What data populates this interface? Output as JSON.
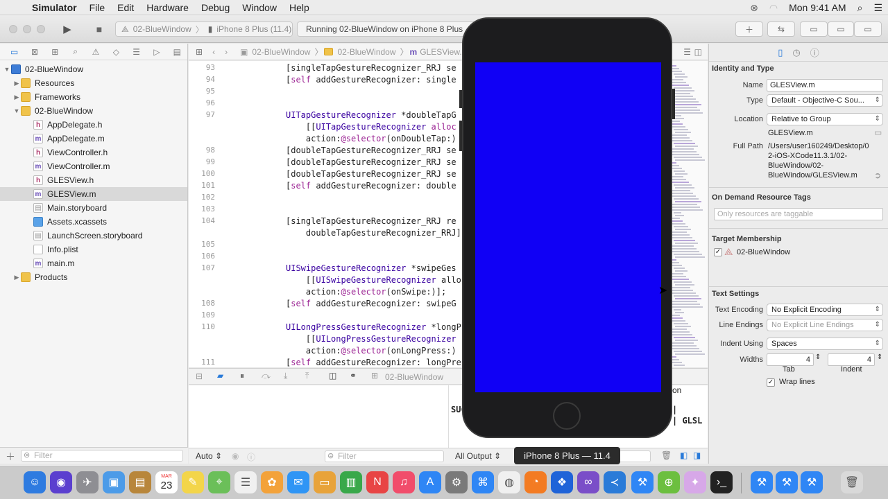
{
  "menubar": {
    "app_name": "Simulator",
    "items": [
      "File",
      "Edit",
      "Hardware",
      "Debug",
      "Window",
      "Help"
    ],
    "clock": "Mon 9:41 AM"
  },
  "toolbar": {
    "scheme": "02-BlueWindow",
    "destination": "iPhone 8 Plus (11.4)",
    "activity": "Running 02-BlueWindow on iPhone 8 Plus"
  },
  "navigator": {
    "items": [
      {
        "label": "02-BlueWindow",
        "kind": "project"
      },
      {
        "label": "Resources",
        "kind": "folder"
      },
      {
        "label": "Frameworks",
        "kind": "folder"
      },
      {
        "label": "02-BlueWindow",
        "kind": "folder"
      },
      {
        "label": "AppDelegate.h",
        "kind": "h"
      },
      {
        "label": "AppDelegate.m",
        "kind": "m"
      },
      {
        "label": "ViewController.h",
        "kind": "h"
      },
      {
        "label": "ViewController.m",
        "kind": "m"
      },
      {
        "label": "GLESView.h",
        "kind": "h"
      },
      {
        "label": "GLESView.m",
        "kind": "m"
      },
      {
        "label": "Main.storyboard",
        "kind": "sb"
      },
      {
        "label": "Assets.xcassets",
        "kind": "xc"
      },
      {
        "label": "LaunchScreen.storyboard",
        "kind": "sb"
      },
      {
        "label": "Info.plist",
        "kind": "pl"
      },
      {
        "label": "main.m",
        "kind": "m"
      },
      {
        "label": "Products",
        "kind": "folder"
      }
    ],
    "filter_placeholder": "Filter"
  },
  "jumpbar": {
    "crumbs": [
      "02-BlueWindow",
      "02-BlueWindow",
      "GLESView.m"
    ]
  },
  "editor": {
    "lines": [
      {
        "n": "93",
        "text": "[singleTapGestureRecognizer_RRJ se"
      },
      {
        "n": "94",
        "text": "[self addGestureRecognizer: single"
      },
      {
        "n": "95",
        "text": ""
      },
      {
        "n": "96",
        "text": ""
      },
      {
        "n": "97",
        "text": "UITapGestureRecognizer *doubleTapG"
      },
      {
        "n": "",
        "text": "    [[UITapGestureRecognizer alloc"
      },
      {
        "n": "",
        "text": "    action:@selector(onDoubleTap:)"
      },
      {
        "n": "98",
        "text": "[doubleTapGestureRecognizer_RRJ se"
      },
      {
        "n": "99",
        "text": "[doubleTapGestureRecognizer_RRJ se"
      },
      {
        "n": "100",
        "text": "[doubleTapGestureRecognizer_RRJ se"
      },
      {
        "n": "101",
        "text": "[self addGestureRecognizer: double"
      },
      {
        "n": "102",
        "text": ""
      },
      {
        "n": "103",
        "text": ""
      },
      {
        "n": "104",
        "text": "[singleTapGestureRecognizer_RRJ re"
      },
      {
        "n": "",
        "text": "    doubleTapGestureRecognizer_RRJ]"
      },
      {
        "n": "105",
        "text": ""
      },
      {
        "n": "106",
        "text": ""
      },
      {
        "n": "107",
        "text": "UISwipeGestureRecognizer *swipeGes"
      },
      {
        "n": "",
        "text": "    [[UISwipeGestureRecognizer allo"
      },
      {
        "n": "",
        "text": "    action:@selector(onSwipe:)];"
      },
      {
        "n": "108",
        "text": "[self addGestureRecognizer: swipeG"
      },
      {
        "n": "109",
        "text": ""
      },
      {
        "n": "110",
        "text": "UILongPressGestureRecognizer *longP"
      },
      {
        "n": "",
        "text": "    [[UILongPressGestureRecognizer"
      },
      {
        "n": "",
        "text": "    action:@selector(onLongPress:)"
      },
      {
        "n": "111",
        "text": "[self addGestureRecognizer: longPre"
      }
    ]
  },
  "debug": {
    "process": "02-BlueWindow",
    "console_partial_1": "SUC",
    "console_partial_2": "| GLSL",
    "console_partial_3": "on",
    "auto_label": "Auto",
    "filter_placeholder": "Filter",
    "output_label": "All Output"
  },
  "inspector": {
    "identity_title": "Identity and Type",
    "name_label": "Name",
    "name_value": "GLESView.m",
    "type_label": "Type",
    "type_value": "Default - Objective-C Sou...",
    "location_label": "Location",
    "location_value": "Relative to Group",
    "location_file": "GLESView.m",
    "full_path_label": "Full Path",
    "full_path_value": "/Users/user160249/Desktop/02-iOS-XCode11.3.1/02-BlueWindow/02-BlueWindow/GLESView.m",
    "on_demand_title": "On Demand Resource Tags",
    "tags_placeholder": "Only resources are taggable",
    "target_title": "Target Membership",
    "target_name": "02-BlueWindow",
    "text_settings_title": "Text Settings",
    "encoding_label": "Text Encoding",
    "encoding_value": "No Explicit Encoding",
    "line_endings_label": "Line Endings",
    "line_endings_value": "No Explicit Line Endings",
    "indent_using_label": "Indent Using",
    "indent_using_value": "Spaces",
    "widths_label": "Widths",
    "tab_value": "4",
    "indent_value": "4",
    "tab_caption": "Tab",
    "indent_caption": "Indent",
    "wrap_label": "Wrap lines"
  },
  "simulator": {
    "device_label": "iPhone 8 Plus — 11.4",
    "screen_color": "#1000f5"
  },
  "dock": {
    "icons": [
      "finder-icon",
      "siri-icon",
      "launchpad-icon",
      "preview-icon",
      "notefile-icon",
      "calendar-icon",
      "notes-icon",
      "maps-icon",
      "reminders-icon",
      "photos-icon",
      "messages-icon",
      "keynote-icon",
      "numbers-icon",
      "news-icon",
      "music-icon",
      "appstore-icon",
      "settings-icon",
      "safari-icon",
      "chrome-icon",
      "firefox-icon",
      "dropbox-icon",
      "visualstudio-icon",
      "vscode-icon",
      "xcode-icon",
      "android-icon",
      "bluebird-icon",
      "terminal-icon",
      "xcode2-icon",
      "xcode3-icon",
      "xcode4-icon",
      "trash-icon"
    ],
    "calendar_month": "MAR",
    "calendar_day": "23"
  }
}
